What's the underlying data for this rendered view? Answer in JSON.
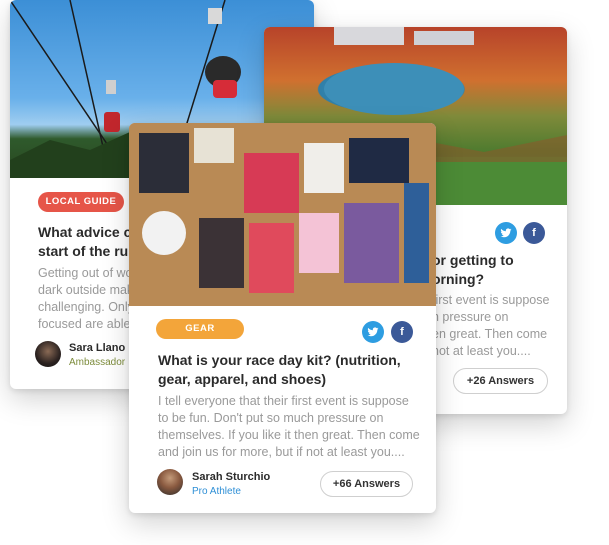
{
  "cards": {
    "left": {
      "tag": "LOCAL GUIDE",
      "tag_color": "#e65548",
      "title_line1": "What advice c",
      "title_line2": "start of the ru",
      "excerpt_lines": [
        "Getting out of wo",
        "dark outside mak",
        "challenging. Only",
        "focused are able"
      ],
      "author": "Sara Llano",
      "role": "Ambassador",
      "role_color": "#7d8c3c"
    },
    "right": {
      "title_line1": "or getting to",
      "title_line2": "orning?",
      "excerpt_lines": [
        "first event is suppose",
        "h pressure on",
        "en great. Then come",
        "not at least you...."
      ],
      "answers": "+26 Answers",
      "twitter_icon": "twitter-icon",
      "facebook_icon": "facebook-icon"
    },
    "front": {
      "tag": "GEAR",
      "tag_color": "#f3a53a",
      "title_line1": "What is your race day kit? (nutrition,",
      "title_line2": "gear, apparel, and shoes)",
      "excerpt_lines": [
        "I tell everyone that their first event is suppose",
        "to be fun. Don't put so much pressure on",
        "themselves. If you like it then great. Then come",
        "and join us for more, but if not at least you...."
      ],
      "author": "Sarah Sturchio",
      "role": "Pro Athlete",
      "role_color": "#2e8fd6",
      "answers": "+66 Answers",
      "twitter_icon": "twitter-icon",
      "facebook_icon": "facebook-icon"
    }
  }
}
